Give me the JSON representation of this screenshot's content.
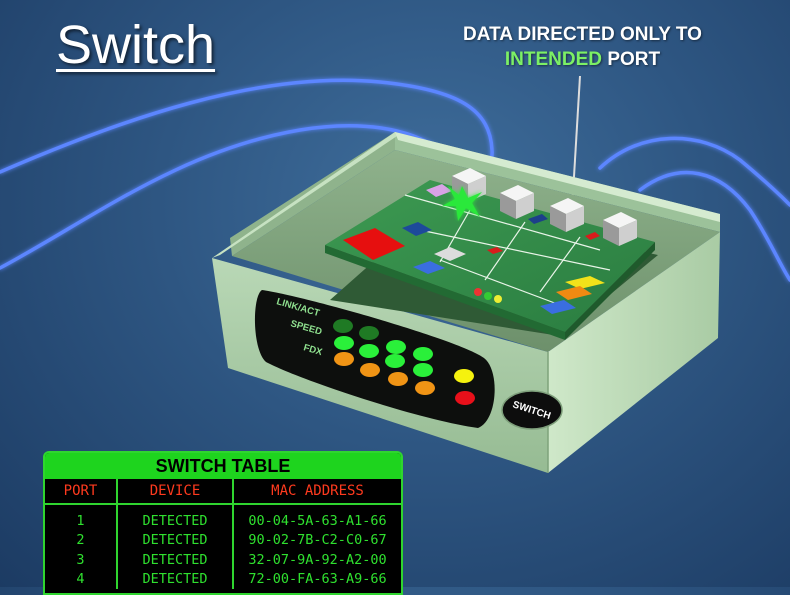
{
  "title": "Switch",
  "callout": {
    "line1": "DATA DIRECTED ONLY TO",
    "line2_highlight": "INTENDED",
    "line2_rest": "PORT"
  },
  "device": {
    "led_labels": [
      "LINK/ACT",
      "SPEED",
      "FDX"
    ],
    "badge": "SWITCH"
  },
  "switch_table": {
    "title": "SWITCH TABLE",
    "columns": [
      "PORT",
      "DEVICE",
      "MAC ADDRESS"
    ],
    "rows": [
      {
        "port": "1",
        "device": "DETECTED",
        "mac": "00-04-5A-63-A1-66"
      },
      {
        "port": "2",
        "device": "DETECTED",
        "mac": "90-02-7B-C2-C0-67"
      },
      {
        "port": "3",
        "device": "DETECTED",
        "mac": "32-07-9A-92-A2-00"
      },
      {
        "port": "4",
        "device": "DETECTED",
        "mac": "72-00-FA-63-A9-66"
      }
    ]
  },
  "colors": {
    "background": "#2e5682",
    "highlight_green": "#7cf065",
    "table_border": "#2fd52f",
    "table_header_text": "#ff3a1e",
    "cable": "#4f7dff"
  }
}
